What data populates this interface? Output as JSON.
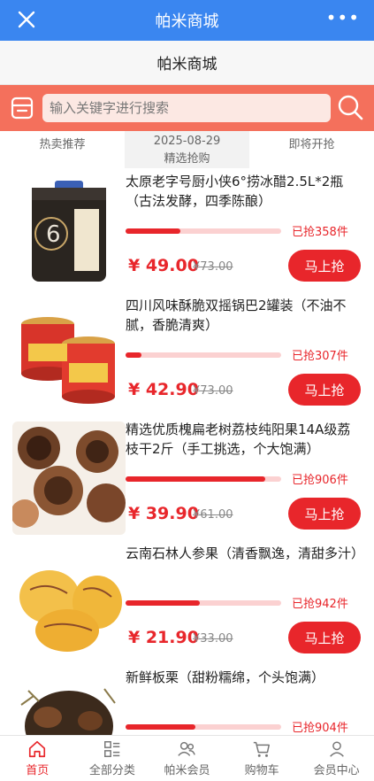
{
  "window": {
    "title": "帕米商城",
    "more": "•••"
  },
  "header": {
    "title": "帕米商城"
  },
  "search": {
    "placeholder": "输入关键字进行搜索"
  },
  "tabs": [
    {
      "label": "热卖推荐"
    },
    {
      "label": "2025-08-29",
      "sub": "精选抢购"
    },
    {
      "label": "即将开抢"
    }
  ],
  "products": [
    {
      "name": "太原老字号厨小侠6°捞冰醋2.5L*2瓶（古法发酵，四季陈酿）",
      "price": "¥ 49.00",
      "old_price": "¥73.00",
      "sold": "已抢358件",
      "progress": 0.35,
      "button": "马上抢"
    },
    {
      "name": "四川风味酥脆双摇锅巴2罐装（不油不腻，香脆清爽）",
      "price": "¥ 42.90",
      "old_price": "¥73.00",
      "sold": "已抢307件",
      "progress": 0.1,
      "button": "马上抢"
    },
    {
      "name": "精选优质槐扁老树荔枝纯阳果14A级荔枝干2斤（手工挑选，个大饱满）",
      "price": "¥ 39.90",
      "old_price": "¥61.00",
      "sold": "已抢906件",
      "progress": 0.9,
      "button": "马上抢"
    },
    {
      "name": "云南石林人参果（清香飘逸，清甜多汁）",
      "price": "¥ 21.90",
      "old_price": "¥33.00",
      "sold": "已抢942件",
      "progress": 0.48,
      "button": "马上抢"
    },
    {
      "name": "新鲜板栗（甜粉糯绵，个头饱满）",
      "price": "",
      "old_price": "",
      "sold": "已抢904件",
      "progress": 0.45,
      "button": ""
    }
  ],
  "tabbar": [
    {
      "label": "首页",
      "icon": "home-icon",
      "active": true
    },
    {
      "label": "全部分类",
      "icon": "category-icon"
    },
    {
      "label": "帕米会员",
      "icon": "members-icon"
    },
    {
      "label": "购物车",
      "icon": "cart-icon"
    },
    {
      "label": "会员中心",
      "icon": "user-icon"
    }
  ],
  "colors": {
    "brand_blue": "#3a86f0",
    "accent_red": "#e8262b",
    "search_bg": "#f4705c"
  }
}
